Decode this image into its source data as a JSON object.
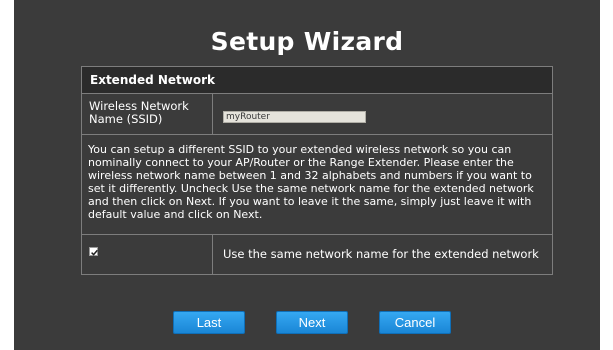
{
  "page": {
    "title": "Setup Wizard"
  },
  "section": {
    "header": "Extended Network",
    "ssid_label": "Wireless Network Name (SSID)",
    "ssid_value": "myRouter",
    "description": "You can setup a different SSID to your extended wireless network so you can nominally connect to your AP/Router or the Range Extender. Please enter the wireless network name between 1 and 32 alphabets and numbers if you want to set it differently. Uncheck Use the same network name for the extended network and then click on Next. If you want to leave it the same, simply just leave it with default value and click on Next.",
    "same_name_checked": true,
    "same_name_label": "Use the same network name for the extended network"
  },
  "buttons": {
    "last": "Last",
    "next": "Next",
    "cancel": "Cancel"
  },
  "colors": {
    "panel": "#3b3b3b",
    "header": "#2b2b2b",
    "button": "#1e90e0"
  }
}
